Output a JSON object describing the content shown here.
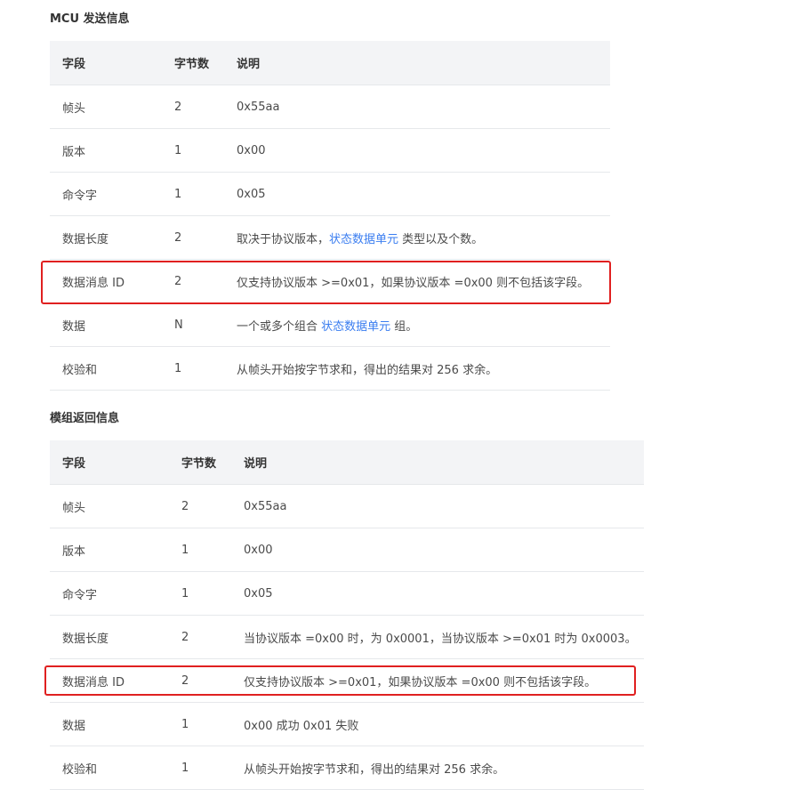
{
  "section1": {
    "title": "MCU 发送信息",
    "headers": [
      "字段",
      "字节数",
      "说明"
    ],
    "rows": [
      {
        "field": "帧头",
        "bytes": "2",
        "desc": "0x55aa"
      },
      {
        "field": "版本",
        "bytes": "1",
        "desc": "0x00"
      },
      {
        "field": "命令字",
        "bytes": "1",
        "desc": "0x05"
      },
      {
        "field": "数据长度",
        "bytes": "2",
        "desc_pre": "取决于协议版本，",
        "desc_link": "状态数据单元",
        "desc_post": " 类型以及个数。"
      },
      {
        "field": "数据消息 ID",
        "bytes": "2",
        "desc": "仅支持协议版本 >=0x01，如果协议版本 =0x00 则不包括该字段。"
      },
      {
        "field": "数据",
        "bytes": "N",
        "desc_pre": "一个或多个组合 ",
        "desc_link": "状态数据单元",
        "desc_post": " 组。"
      },
      {
        "field": "校验和",
        "bytes": "1",
        "desc": "从帧头开始按字节求和，得出的结果对 256 求余。"
      }
    ]
  },
  "section2": {
    "title": "模组返回信息",
    "headers": [
      "字段",
      "字节数",
      "说明"
    ],
    "rows": [
      {
        "field": "帧头",
        "bytes": "2",
        "desc": "0x55aa"
      },
      {
        "field": "版本",
        "bytes": "1",
        "desc": "0x00"
      },
      {
        "field": "命令字",
        "bytes": "1",
        "desc": "0x05"
      },
      {
        "field": "数据长度",
        "bytes": "2",
        "desc": "当协议版本 =0x00 时，为 0x0001，当协议版本 >=0x01 时为 0x0003。"
      },
      {
        "field": "数据消息 ID",
        "bytes": "2",
        "desc": "仅支持协议版本 >=0x01，如果协议版本 =0x00 则不包括该字段。"
      },
      {
        "field": "数据",
        "bytes": "1",
        "desc": "0x00 成功 0x01 失败"
      },
      {
        "field": "校验和",
        "bytes": "1",
        "desc": "从帧头开始按字节求和，得出的结果对 256 求余。"
      }
    ]
  },
  "colors": {
    "link": "#3a7df0",
    "highlight": "#e02020",
    "header_bg": "#f3f4f6"
  }
}
